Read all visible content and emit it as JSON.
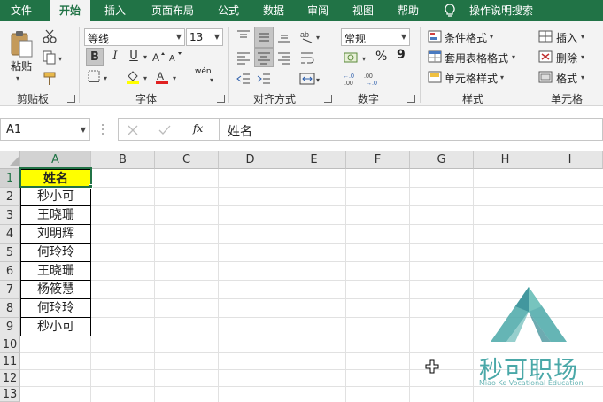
{
  "tabs": [
    {
      "label": "文件",
      "active": false
    },
    {
      "label": "开始",
      "active": true
    },
    {
      "label": "插入",
      "active": false
    },
    {
      "label": "页面布局",
      "active": false
    },
    {
      "label": "公式",
      "active": false
    },
    {
      "label": "数据",
      "active": false
    },
    {
      "label": "审阅",
      "active": false
    },
    {
      "label": "视图",
      "active": false
    },
    {
      "label": "帮助",
      "active": false
    }
  ],
  "tell_me": "操作说明搜索",
  "ribbon": {
    "clipboard": {
      "paste_label": "粘贴",
      "group_label": "剪贴板"
    },
    "font": {
      "font_name": "等线",
      "font_size": "13",
      "bold": "B",
      "italic": "I",
      "underline": "U",
      "phonetic": "wén",
      "group_label": "字体"
    },
    "alignment": {
      "group_label": "对齐方式"
    },
    "number": {
      "format": "常规",
      "percent": "%",
      "comma": "9",
      "group_label": "数字"
    },
    "styles": {
      "conditional": "条件格式",
      "table": "套用表格格式",
      "cell_styles": "单元格样式",
      "group_label": "样式"
    },
    "cells": {
      "insert": "插入",
      "delete": "删除",
      "format": "格式",
      "group_label": "单元格"
    }
  },
  "formula_bar": {
    "name_box": "A1",
    "fx": "fx",
    "content": "姓名"
  },
  "columns": [
    "A",
    "B",
    "C",
    "D",
    "E",
    "F",
    "G",
    "H",
    "I"
  ],
  "rows": [
    "1",
    "2",
    "3",
    "4",
    "5",
    "6",
    "7",
    "8",
    "9",
    "10",
    "11",
    "12",
    "13"
  ],
  "cells": [
    "姓名",
    "秒小可",
    "王晓珊",
    "刘明辉",
    "何玲玲",
    "王晓珊",
    "杨筱慧",
    "何玲玲",
    "秒小可"
  ],
  "watermark": {
    "title": "秒可职场",
    "subtitle": "Miao Ke Vocational Education"
  },
  "colors": {
    "accent": "#217346",
    "header_fill": "#ffff00",
    "logo": "#4aa8a8"
  }
}
